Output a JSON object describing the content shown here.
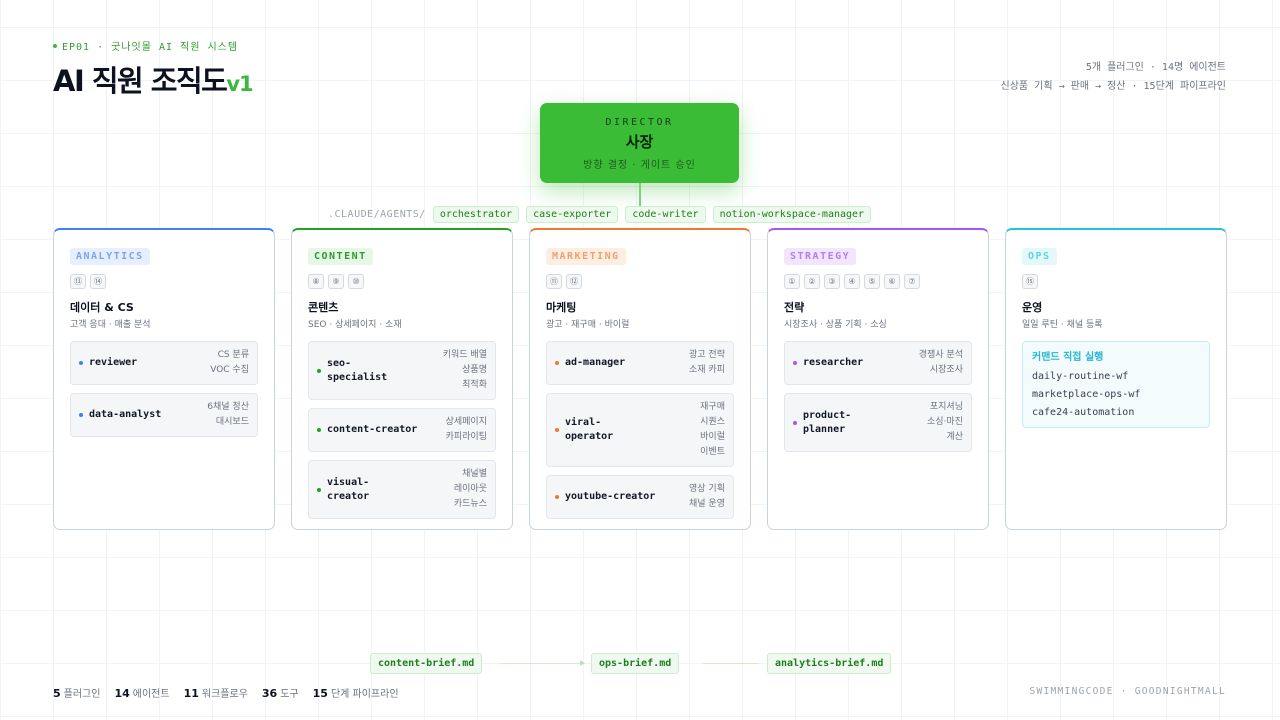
{
  "header": {
    "episode": "EP01 · 굿나잇몰 AI 직원 시스템",
    "title": "AI 직원 조직도",
    "version": "v1",
    "summary_line1": "5개 플러그인 · 14명 에이전트",
    "summary_line2": "신상품 기획 → 판매 → 정산 · 15단계 파이프라인"
  },
  "director": {
    "role": "DIRECTOR",
    "name": "사장",
    "subtitle": "방향 결정 · 게이트 승인"
  },
  "agents_path": {
    "prefix": ".CLAUDE/AGENTS/",
    "chips": [
      "orchestrator",
      "case-exporter",
      "code-writer",
      "notion-workspace-manager"
    ]
  },
  "teams": [
    {
      "tag": "ANALYTICS",
      "color": "#3b82f6",
      "tag_bg": "#e6efff",
      "tag_color": "#7aa4f0",
      "steps": [
        "⑬",
        "⑭"
      ],
      "name": "데이터 & CS",
      "desc": "고객 응대 · 매출 분석",
      "agents": [
        {
          "name": "reviewer",
          "note": "CS 분류\nVOC 수집"
        },
        {
          "name": "data-analyst",
          "note": "6채널 정산\n대시보드"
        }
      ]
    },
    {
      "tag": "CONTENT",
      "color": "#22a322",
      "tag_bg": "#e6f7e6",
      "tag_color": "#2e9a2e",
      "steps": [
        "⑧",
        "⑨",
        "⑩"
      ],
      "name": "콘텐츠",
      "desc": "SEO · 상세페이지 · 소재",
      "agents": [
        {
          "name": "seo-specialist",
          "display": "seo-\nspecialist",
          "note": "키워드 배열\n상품명\n최적화"
        },
        {
          "name": "content-creator",
          "note": "상세페이지\n카피라이팅"
        },
        {
          "name": "visual-creator",
          "display": "visual-\ncreator",
          "note": "채널별\n레이아웃\n카드뉴스"
        }
      ]
    },
    {
      "tag": "MARKETING",
      "color": "#f07a2a",
      "tag_bg": "#fdeee2",
      "tag_color": "#f0a070",
      "steps": [
        "⑪",
        "⑫"
      ],
      "name": "마케팅",
      "desc": "광고 · 재구매 · 바이럴",
      "agents": [
        {
          "name": "ad-manager",
          "note": "광고 전략\n소재 카피"
        },
        {
          "name": "viral-operator",
          "display": "viral-\noperator",
          "note": "재구매\n시퀀스\n바이럴\n이벤트"
        },
        {
          "name": "youtube-creator",
          "note": "영상 기획\n채널 운영"
        }
      ]
    },
    {
      "tag": "STRATEGY",
      "color": "#a855f7",
      "tag_bg": "#f1e6fd",
      "tag_color": "#b57ef0",
      "steps": [
        "①",
        "②",
        "③",
        "④",
        "⑤",
        "⑥",
        "⑦"
      ],
      "name": "전략",
      "desc": "시장조사 · 상품 기획 · 소싱",
      "agents": [
        {
          "name": "researcher",
          "note": "경쟁사 분석\n시장조사"
        },
        {
          "name": "product-planner",
          "display": "product-\nplanner",
          "note": "포지셔닝\n소싱·마진\n계산"
        }
      ]
    },
    {
      "tag": "OPS",
      "color": "#22c3dd",
      "tag_bg": "#e4f8fb",
      "tag_color": "#5fd2e3",
      "steps": [
        "⑮"
      ],
      "name": "운영",
      "desc": "일일 루틴 · 채널 등록",
      "command_box": {
        "title": "커맨드 직접 실행",
        "items": [
          "daily-routine-wf",
          "marketplace-ops-wf",
          "cafe24-automation"
        ]
      }
    }
  ],
  "briefs": [
    "content-brief.md",
    "ops-brief.md",
    "analytics-brief.md"
  ],
  "footer": {
    "stats": [
      {
        "value": "5",
        "label": "플러그인"
      },
      {
        "value": "14",
        "label": "에이전트"
      },
      {
        "value": "11",
        "label": "워크플로우"
      },
      {
        "value": "36",
        "label": "도구"
      },
      {
        "value": "15",
        "label": "단계 파이프라인"
      }
    ],
    "credit": "SWIMMINGCODE · GOODNIGHTMALL"
  }
}
